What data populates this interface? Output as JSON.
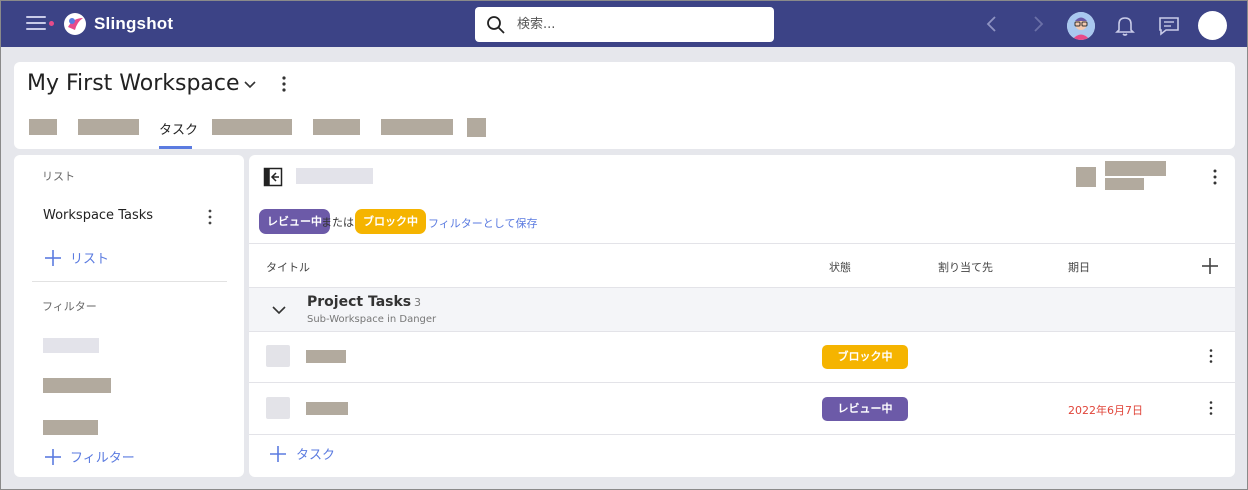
{
  "app": {
    "brand": "Slingshot"
  },
  "search": {
    "placeholder": "検索..."
  },
  "workspace": {
    "title": "My First Workspace",
    "tabs": [
      {
        "label": "タスク",
        "active": true
      }
    ]
  },
  "sidebar": {
    "lists_label": "リスト",
    "list_items": [
      {
        "label": "Workspace Tasks"
      }
    ],
    "add_list_label": "リスト",
    "filters_label": "フィルター",
    "add_filter_label": "フィルター"
  },
  "main": {
    "filter": {
      "chip1": "レビュー中",
      "connector": "または",
      "chip2": "ブロック中",
      "save_label": "フィルターとして保存"
    },
    "columns": {
      "title": "タイトル",
      "status": "状態",
      "assignee": "割り当て先",
      "due": "期日"
    },
    "group": {
      "name": "Project Tasks",
      "count": "3",
      "subtitle": "Sub-Workspace in Danger"
    },
    "tasks": [
      {
        "status": "ブロック中",
        "status_color": "#f5b400",
        "due": ""
      },
      {
        "status": "レビュー中",
        "status_color": "#6c5aa8",
        "due": "2022年6月7日"
      }
    ],
    "add_task_label": "タスク"
  },
  "colors": {
    "topbar": "#3c4386",
    "accent": "#5b7be0",
    "review": "#6c5aa8",
    "blocked": "#f5b400",
    "due_alert": "#e0453a"
  }
}
